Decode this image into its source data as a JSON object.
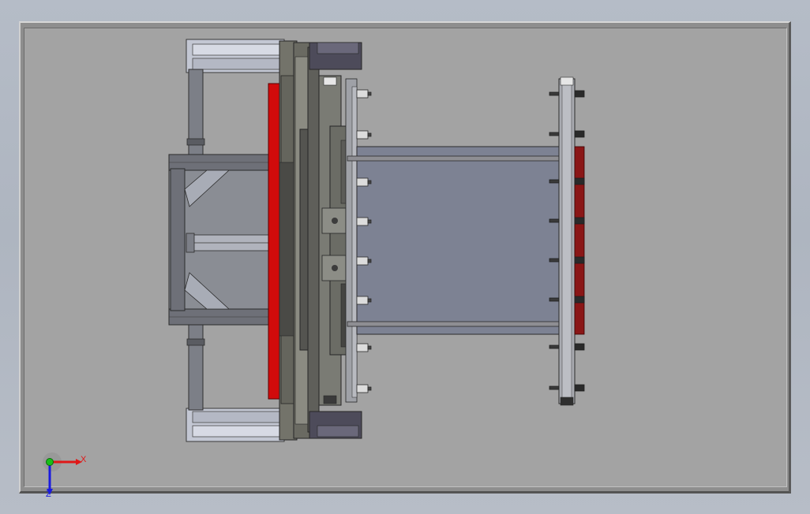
{
  "window": {
    "title": ""
  },
  "graphics_area": {
    "background_color": "#b5bcc7",
    "sheet_color": "#a3a3a3",
    "view": "Top",
    "model": {
      "name": "",
      "colors": {
        "frame_steel": "#7c7f87",
        "frame_light": "#c3c7d3",
        "plate_dark": "#5f5f5a",
        "plate_olive": "#73736a",
        "platen_red": "#d10b0b",
        "plate_blue_grey": "#7d8293",
        "rod": "#8e8e93",
        "bolt": "#dcdcdc",
        "dark_red": "#8a1616"
      }
    }
  },
  "triad": {
    "x_label": "X",
    "z_label": "Z",
    "x_color": "#e01818",
    "y_color": "#18c018",
    "z_color": "#1a1ae0"
  }
}
